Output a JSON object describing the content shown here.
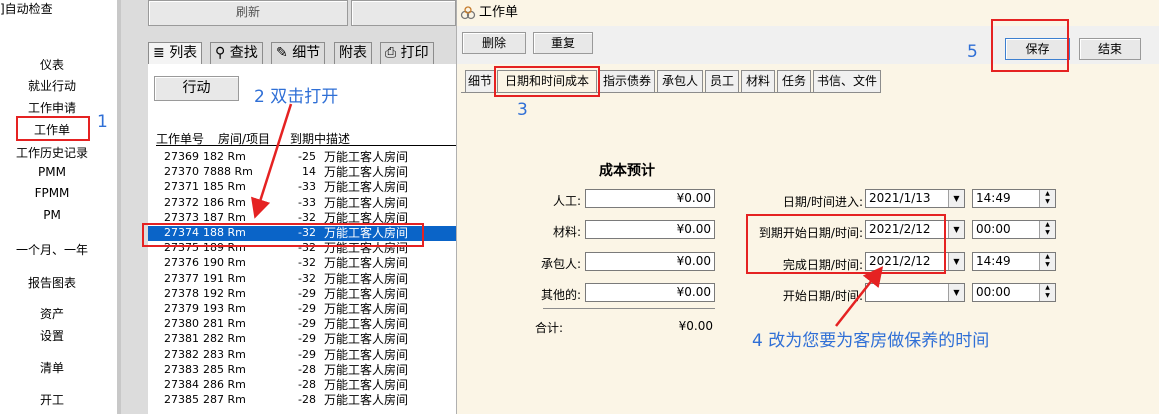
{
  "left_nav": {
    "top_label": "]自动检查",
    "items": [
      "仪表",
      "就业行动",
      "工作申请",
      "工作单",
      "工作历史记录",
      "PMM",
      "FPMM",
      "PM",
      "一个月、一年",
      "报告图表",
      "资产",
      "设置",
      "清单",
      "开工"
    ]
  },
  "list_panel": {
    "top_button_partial": "刷新",
    "tabs": [
      "列表",
      "查找",
      "细节",
      "附表",
      "打印"
    ],
    "action_button": "行动",
    "columns": [
      "工作单号",
      "房间/项目",
      "到期中",
      "描述"
    ],
    "rows": [
      [
        "27369",
        "182 Rm",
        "-25",
        "万能工客人房间"
      ],
      [
        "27370",
        "7888 Rm",
        "14",
        "万能工客人房间"
      ],
      [
        "27371",
        "185 Rm",
        "-33",
        "万能工客人房间"
      ],
      [
        "27372",
        "186 Rm",
        "-33",
        "万能工客人房间"
      ],
      [
        "27373",
        "187 Rm",
        "-32",
        "万能工客人房间"
      ],
      [
        "27374",
        "188 Rm",
        "-32",
        "万能工客人房间"
      ],
      [
        "27375",
        "189 Rm",
        "-32",
        "万能工客人房间"
      ],
      [
        "27376",
        "190 Rm",
        "-32",
        "万能工客人房间"
      ],
      [
        "27377",
        "191 Rm",
        "-32",
        "万能工客人房间"
      ],
      [
        "27378",
        "192 Rm",
        "-29",
        "万能工客人房间"
      ],
      [
        "27379",
        "193 Rm",
        "-29",
        "万能工客人房间"
      ],
      [
        "27380",
        "281 Rm",
        "-29",
        "万能工客人房间"
      ],
      [
        "27381",
        "282 Rm",
        "-29",
        "万能工客人房间"
      ],
      [
        "27382",
        "283 Rm",
        "-29",
        "万能工客人房间"
      ],
      [
        "27383",
        "285 Rm",
        "-28",
        "万能工客人房间"
      ],
      [
        "27384",
        "286 Rm",
        "-28",
        "万能工客人房间"
      ],
      [
        "27385",
        "287 Rm",
        "-28",
        "万能工客人房间"
      ]
    ],
    "selected_row": "27374"
  },
  "dialog": {
    "title": "工作单",
    "toolbar": {
      "delete": "删除",
      "reset": "重复",
      "save": "保存",
      "finish": "结束"
    },
    "tabs": [
      "细节",
      "日期和时间成本",
      "指示债券",
      "承包人",
      "员工",
      "材料",
      "任务",
      "书信、文件"
    ],
    "cost": {
      "heading": "成本预计",
      "labor_label": "人工:",
      "labor_value": "¥0.00",
      "material_label": "材料:",
      "material_value": "¥0.00",
      "contractor_label": "承包人:",
      "contractor_value": "¥0.00",
      "other_label": "其他的:",
      "other_value": "¥0.00",
      "total_label": "合计:",
      "total_value": "¥0.00"
    },
    "dates": {
      "entered_label": "日期/时间进入:",
      "entered_date": "2021/1/13",
      "entered_time": "14:49",
      "due_label": "到期开始日期/时间:",
      "due_date": "2021/2/12",
      "due_time": "00:00",
      "complete_label": "完成日期/时间:",
      "complete_date": "2021/2/12",
      "complete_time": "14:49",
      "start_label": "开始日期/时间:",
      "start_date": "",
      "start_time": "00:00"
    }
  },
  "annotations": {
    "n1": "1",
    "n2": "2 双击打开",
    "n3": "3",
    "n4": "4 改为您要为客房做保养的时间",
    "n5": "5"
  },
  "colors": {
    "annotation_blue": "#2f6fd6",
    "annotation_red": "#e52222",
    "selection_blue": "#0a64c8"
  }
}
